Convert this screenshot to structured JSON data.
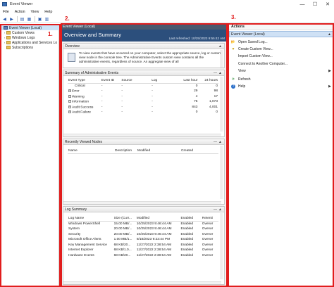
{
  "window": {
    "title": "Event Viewer",
    "controls": [
      "—",
      "☐",
      "✕"
    ]
  },
  "menu": [
    "File",
    "Action",
    "View",
    "Help"
  ],
  "tree": {
    "items": [
      {
        "label": "Event Viewer (Local)",
        "arrow": "",
        "icon": "event-viewer-icon",
        "selected": true
      },
      {
        "label": "Custom Views",
        "arrow": "›",
        "icon": "folder-icon"
      },
      {
        "label": "Windows Logs",
        "arrow": "›",
        "icon": "folder-icon"
      },
      {
        "label": "Applications and Services Lo",
        "arrow": "›",
        "icon": "folder-icon"
      },
      {
        "label": "Subscriptions",
        "arrow": "",
        "icon": "folder-icon"
      }
    ]
  },
  "center": {
    "header": "Event Viewer (Local)",
    "banner_title": "Overview and Summary",
    "banner_sub": "Last refreshed: 10/25/2023 9:55:42 AM",
    "overview": {
      "title": "Overview",
      "text": "To view events that have occurred on your computer, select the appropriate source, log or custom view node in the console tree. The Administrative Events custom view contains all the administrative events, regardless of source. An aggregate view of all"
    },
    "summary": {
      "title": "Summary of Administrative Events",
      "columns": [
        "Event Type",
        "Event ID",
        "Source",
        "Log",
        "Last hour",
        "24 hours"
      ],
      "rows": [
        [
          "Critical",
          "-",
          "-",
          "-",
          "0",
          "0"
        ],
        [
          "Error",
          "-",
          "-",
          "-",
          "29",
          "98"
        ],
        [
          "Warning",
          "-",
          "-",
          "-",
          "4",
          "17"
        ],
        [
          "Information",
          "-",
          "-",
          "-",
          "75",
          "1,073"
        ],
        [
          "Audit Success",
          "-",
          "-",
          "-",
          "843",
          "4,001"
        ],
        [
          "Audit Failure",
          "-",
          "-",
          "-",
          "0",
          "0"
        ]
      ]
    },
    "recent": {
      "title": "Recently Viewed Nodes",
      "columns": [
        "Name",
        "Description",
        "Modified",
        "Created"
      ]
    },
    "logs": {
      "title": "Log Summary",
      "columns": [
        "Log Name",
        "Size (Curr...",
        "Modified",
        "Enabled",
        "Retenti"
      ],
      "rows": [
        [
          "Windows PowerShell",
          "15.00 MB/...",
          "10/25/2023 9:46:44 AM",
          "Enabled",
          "Overwr"
        ],
        [
          "System",
          "20.00 MB/...",
          "10/25/2023 9:46:44 AM",
          "Enabled",
          "Overwr"
        ],
        [
          "Security",
          "20.00 MB/...",
          "10/25/2023 9:46:44 AM",
          "Enabled",
          "Overwr"
        ],
        [
          "Microsoft Office Alerts",
          "1.00 MB/1...",
          "9/18/2023 9:23:44 PM",
          "Enabled",
          "Overwr"
        ],
        [
          "Key Management Service",
          "68 KB/20...",
          "11/27/2022 2:38:54 AM",
          "Enabled",
          "Overwr"
        ],
        [
          "Internet Explorer",
          "68 KB/1.0...",
          "11/27/2022 2:38:54 AM",
          "Enabled",
          "Overwr"
        ],
        [
          "Hardware Events",
          "68 KB/20...",
          "11/27/2022 2:38:54 AM",
          "Enabled",
          "Overwr"
        ]
      ]
    }
  },
  "actions": {
    "title": "Actions",
    "section": "Event Viewer (Local)",
    "items": [
      {
        "label": "Open Saved Log...",
        "icon": "folder-open-icon",
        "glyph": "📂",
        "arrow": ""
      },
      {
        "label": "Create Custom View...",
        "icon": "filter-icon",
        "glyph": "▼",
        "arrow": ""
      },
      {
        "label": "Import Custom View...",
        "icon": "",
        "glyph": "",
        "arrow": ""
      },
      {
        "label": "Connect to Another Computer...",
        "icon": "",
        "glyph": "",
        "arrow": ""
      },
      {
        "label": "View",
        "icon": "",
        "glyph": "",
        "arrow": "▶"
      },
      {
        "label": "Refresh",
        "icon": "refresh-icon",
        "glyph": "⟳",
        "arrow": ""
      },
      {
        "label": "Help",
        "icon": "help-icon",
        "glyph": "?",
        "arrow": "▶"
      }
    ]
  },
  "annotations": [
    "1.",
    "2.",
    "3."
  ],
  "colors": {
    "annotation": "#e11d1d",
    "banner": "#2c4f7c",
    "selection": "#cde3f7"
  }
}
